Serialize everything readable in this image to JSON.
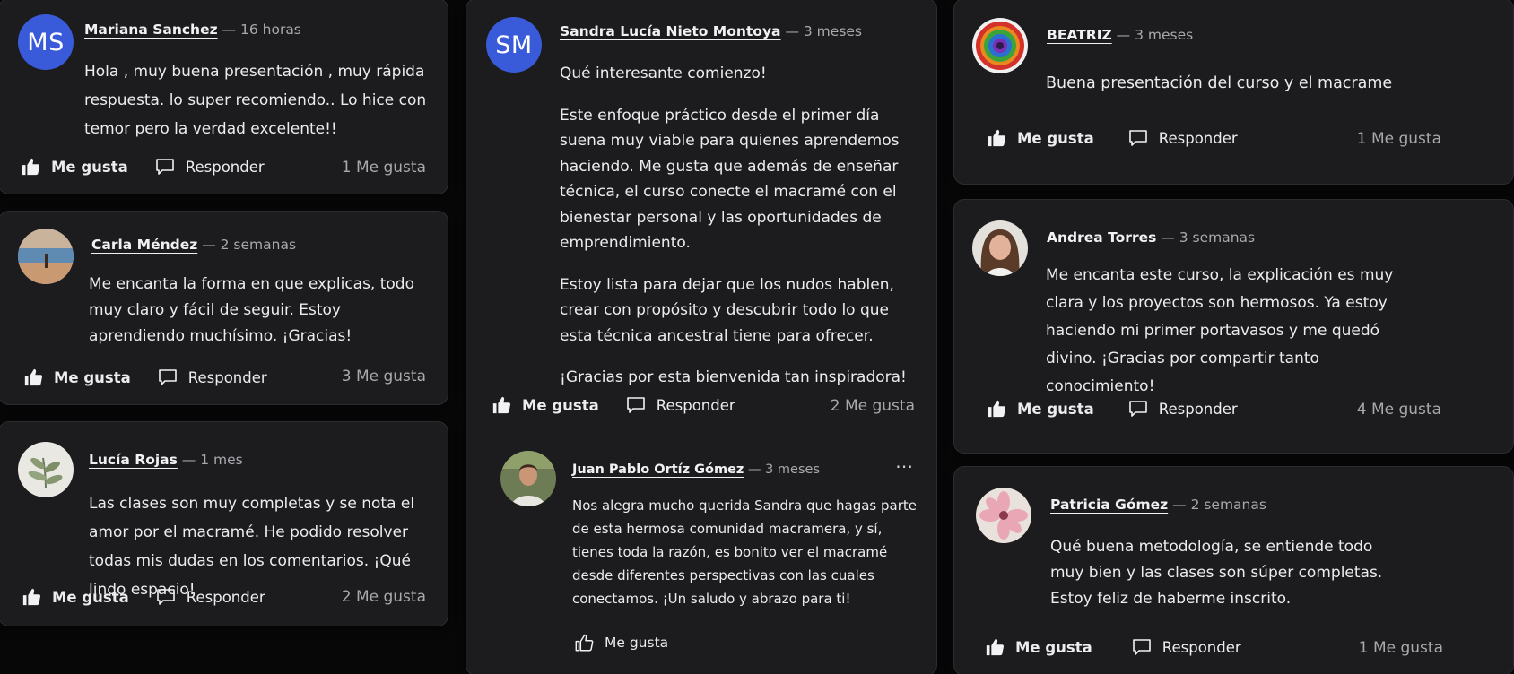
{
  "ui": {
    "like_label": "Me gusta",
    "reply_label": "Responder",
    "more_icon": "⋯"
  },
  "comments": {
    "mariana": {
      "initials": "MS",
      "author": "Mariana Sanchez",
      "time": "16 horas",
      "body": "Hola , muy buena presentación , muy rápida respuesta.  lo  super recomiendo.. Lo hice con temor pero la verdad excelente!!",
      "likes": "1 Me gusta"
    },
    "carla": {
      "author": "Carla Méndez",
      "time": "2 semanas",
      "body": "Me encanta la forma en que explicas, todo muy claro y fácil de seguir. Estoy aprendiendo muchísimo. ¡Gracias!",
      "likes": "3 Me gusta"
    },
    "lucia": {
      "author": "Lucía Rojas",
      "time": "1 mes",
      "body": "Las clases son muy completas y se nota el amor por el macramé. He podido resolver todas mis dudas en los comentarios. ¡Qué lindo espacio!",
      "likes": "2 Me gusta"
    },
    "sandra": {
      "initials": "SM",
      "author": "Sandra Lucía Nieto Montoya",
      "time": "3 meses",
      "paragraphs": [
        "Qué interesante comienzo!",
        "Este enfoque práctico desde el primer día suena muy viable para quienes aprendemos haciendo. Me gusta que además de enseñar técnica, el curso conecte el macramé con el bienestar personal y las oportunidades de emprendimiento.",
        "Estoy lista para dejar que los nudos hablen, crear con propósito y descubrir todo lo que esta técnica ancestral tiene para ofrecer.",
        "¡Gracias por esta bienvenida tan inspiradora!"
      ],
      "likes": "2 Me gusta"
    },
    "juan": {
      "author": "Juan Pablo Ortíz Gómez",
      "time": "3 meses",
      "body": "Nos alegra mucho querida Sandra que hagas parte de esta hermosa comunidad macramera, y sí, tienes toda la razón, es bonito ver el macramé desde diferentes perspectivas con las cuales conectamos. ¡Un saludo y abrazo para ti!"
    },
    "beatriz": {
      "author": "BEATRIZ",
      "time": "3 meses",
      "body": "Buena presentación del curso y el macrame",
      "likes": "1 Me gusta"
    },
    "andrea": {
      "author": "Andrea Torres",
      "time": "3 semanas",
      "body": "Me encanta este curso, la explicación es muy clara y los proyectos son hermosos. Ya estoy haciendo mi primer portavasos y me quedó divino. ¡Gracias por compartir tanto conocimiento!",
      "likes": "4 Me gusta"
    },
    "patricia": {
      "author": "Patricia Gómez",
      "time": "2 semanas",
      "body": "Qué buena metodología, se entiende todo muy bien y las clases son súper completas. Estoy feliz de haberme inscrito.",
      "likes": "1 Me gusta"
    }
  }
}
